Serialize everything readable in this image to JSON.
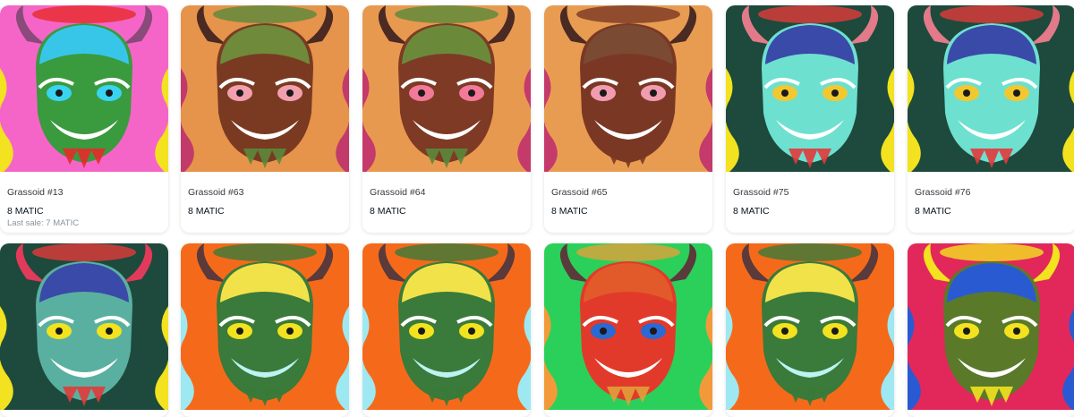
{
  "rows": [
    {
      "items": [
        {
          "name": "Grassoid #13",
          "price": "8 MATIC",
          "last_sale": "Last sale: 7 MATIC",
          "bg": "#f565c8",
          "head": "#3a9a3e",
          "cap": "#38c6e8",
          "horn": "#8a4a7a",
          "eye": "#39d4f2",
          "mouth": "#ffffff",
          "side": "#f2e21f",
          "drip": "#e82a2a"
        },
        {
          "name": "Grassoid #63",
          "price": "8 MATIC",
          "last_sale": "",
          "bg": "#e6934c",
          "head": "#7a3a22",
          "cap": "#6e8a3a",
          "horn": "#4a2a22",
          "eye": "#f2a0b0",
          "mouth": "#ffffff",
          "side": "#c23a6a",
          "drip": "#5a8a3a"
        },
        {
          "name": "Grassoid #64",
          "price": "8 MATIC",
          "last_sale": "",
          "bg": "#e89950",
          "head": "#7e3a24",
          "cap": "#6a8a3a",
          "horn": "#4a2a22",
          "eye": "#f27a98",
          "mouth": "#ffffff",
          "side": "#c43a6a",
          "drip": "#5a8a3a"
        },
        {
          "name": "Grassoid #65",
          "price": "8 MATIC",
          "last_sale": "",
          "bg": "#e89c52",
          "head": "#7a3824",
          "cap": "#7a4a32",
          "horn": "#4a2a22",
          "eye": "#f29cb0",
          "mouth": "#ffffff",
          "side": "#c43a6a",
          "drip": "#7a3824"
        },
        {
          "name": "Grassoid #75",
          "price": "8 MATIC",
          "last_sale": "",
          "bg": "#1d4a3c",
          "head": "#6ee0d0",
          "cap": "#3a4aa8",
          "horn": "#e27a8a",
          "eye": "#f2c830",
          "mouth": "#ffffff",
          "side": "#f2e21f",
          "drip": "#e23a3a"
        },
        {
          "name": "Grassoid #76",
          "price": "8 MATIC",
          "last_sale": "",
          "bg": "#1d4a3c",
          "head": "#6ee0d0",
          "cap": "#3a4aa8",
          "horn": "#e27a8a",
          "eye": "#f2c830",
          "mouth": "#ffffff",
          "side": "#f2e21f",
          "drip": "#e23a3a"
        }
      ]
    },
    {
      "items": [
        {
          "name": "",
          "price": "",
          "last_sale": "",
          "bg": "#1d4a3c",
          "head": "#5ab0a0",
          "cap": "#3a4aa8",
          "horn": "#e23a5a",
          "eye": "#f2e21f",
          "mouth": "#ffffff",
          "side": "#f2e21f",
          "drip": "#e23a3a"
        },
        {
          "name": "",
          "price": "",
          "last_sale": "",
          "bg": "#f56a1a",
          "head": "#3a7a3a",
          "cap": "#f2e24a",
          "horn": "#5a3a3a",
          "eye": "#f2e21f",
          "mouth": "#bff2f2",
          "side": "#9ee8f2",
          "drip": "#3a7a3a"
        },
        {
          "name": "",
          "price": "",
          "last_sale": "",
          "bg": "#f56a1a",
          "head": "#3a7a3a",
          "cap": "#f2e24a",
          "horn": "#5a3a3a",
          "eye": "#f2e21f",
          "mouth": "#bff2f2",
          "side": "#9ee8f2",
          "drip": "#3a7a3a"
        },
        {
          "name": "",
          "price": "",
          "last_sale": "",
          "bg": "#2ad05a",
          "head": "#e23a2a",
          "cap": "#e25a2a",
          "horn": "#5a3a3a",
          "eye": "#2a6ad2",
          "mouth": "#ffffff",
          "side": "#f29a3a",
          "drip": "#e2a03a"
        },
        {
          "name": "",
          "price": "",
          "last_sale": "",
          "bg": "#f56a1a",
          "head": "#3a7a3a",
          "cap": "#f2e24a",
          "horn": "#5a3a3a",
          "eye": "#f2e21f",
          "mouth": "#bff2f2",
          "side": "#9ee8f2",
          "drip": "#3a7a3a"
        },
        {
          "name": "",
          "price": "",
          "last_sale": "",
          "bg": "#e2285a",
          "head": "#5a7a2a",
          "cap": "#2a5ad2",
          "horn": "#f2e21f",
          "eye": "#f2e21f",
          "mouth": "#ffffff",
          "side": "#2a5ad2",
          "drip": "#f2e21f"
        }
      ]
    }
  ]
}
